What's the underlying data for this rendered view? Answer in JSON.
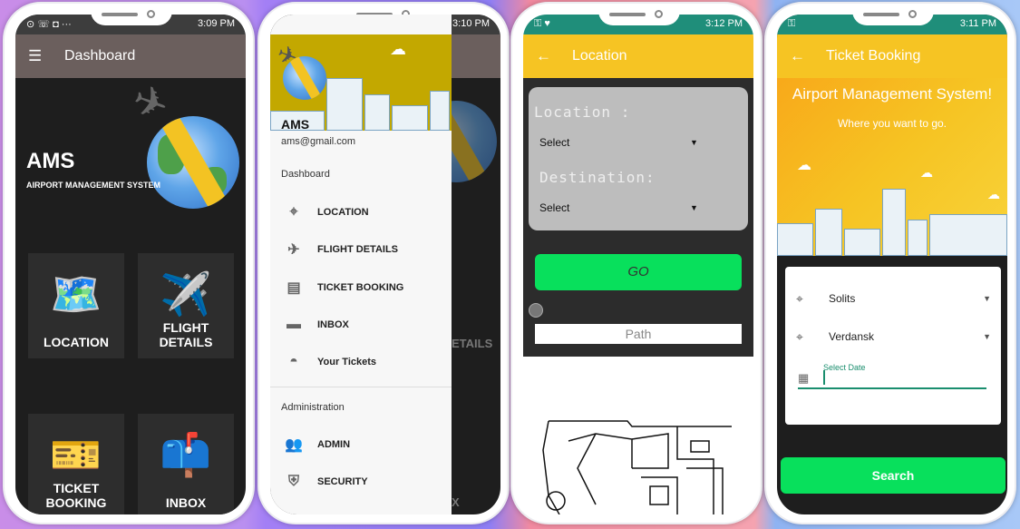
{
  "phone1": {
    "status_time": "3:09 PM",
    "status_battery": "% 🔋",
    "title": "Dashboard",
    "ams_title": "AMS",
    "ams_subtitle": "AIRPORT MANAGEMENT SYSTEM",
    "tiles": [
      {
        "label": "LOCATION",
        "icon": "map-pin-icon",
        "glyph": "🗺️"
      },
      {
        "label": "FLIGHT DETAILS",
        "icon": "airplane-icon",
        "glyph": "✈️"
      },
      {
        "label": "TICKET BOOKING",
        "icon": "ticket-icon",
        "glyph": "🎫"
      },
      {
        "label": "INBOX",
        "icon": "mailbox-icon",
        "glyph": "📫"
      }
    ]
  },
  "phone2": {
    "status_time": "3:10 PM",
    "ams_title": "AMS",
    "email": "ams@gmail.com",
    "section_dashboard": "Dashboard",
    "items": [
      {
        "label": "LOCATION",
        "icon": "location-pin-icon",
        "glyph": "⌖"
      },
      {
        "label": "FLIGHT DETAILS",
        "icon": "airplane-icon",
        "glyph": "✈"
      },
      {
        "label": "TICKET BOOKING",
        "icon": "ticket-icon",
        "glyph": "▤"
      },
      {
        "label": "INBOX",
        "icon": "mailbox-icon",
        "glyph": "▬"
      },
      {
        "label": "Your Tickets",
        "icon": "user-ticket-icon",
        "glyph": "◓"
      }
    ],
    "section_admin": "Administration",
    "admin_items": [
      {
        "label": "ADMIN",
        "icon": "people-icon",
        "glyph": "👥"
      },
      {
        "label": "SECURITY",
        "icon": "shield-icon",
        "glyph": "⛨"
      }
    ],
    "behind_text": "ETAILS",
    "behind_text2": "X"
  },
  "phone3": {
    "status_time": "3:12 PM",
    "title": "Location",
    "location_label": "Location :",
    "location_value": "Select",
    "destination_label": "Destination:",
    "destination_value": "Select",
    "go_label": "GO",
    "path_placeholder": "Path"
  },
  "phone4": {
    "status_time": "3:11 PM",
    "title": "Ticket Booking",
    "hero_title": "Airport Management System!",
    "hero_subtitle": "Where you want to go.",
    "from_value": "Solits",
    "to_value": "Verdansk",
    "date_label": "Select Date",
    "search_label": "Search"
  },
  "colors": {
    "dark": "#1e1e1e",
    "appbar_brown": "#6b5f5d",
    "yellow": "#f6c423",
    "green": "#08e05c"
  }
}
